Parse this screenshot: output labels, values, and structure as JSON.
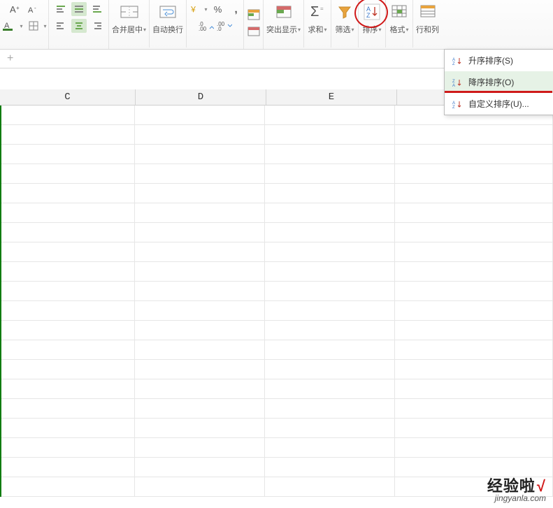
{
  "ribbon": {
    "font_group": {},
    "merge": {
      "label": "合并居中"
    },
    "wrap": {
      "label": "自动换行"
    },
    "number": {
      "inc": ".0",
      "dec": ".00"
    },
    "highlight": {
      "label": "突出显示"
    },
    "sum": {
      "label": "求和"
    },
    "filter": {
      "label": "筛选"
    },
    "sort": {
      "label": "排序"
    },
    "format": {
      "label": "格式"
    },
    "rowcol": {
      "label": "行和列"
    }
  },
  "dropdown": {
    "asc": "升序排序(S)",
    "desc": "降序排序(O)",
    "custom": "自定义排序(U)..."
  },
  "columns": [
    "C",
    "D",
    "E"
  ],
  "watermark": {
    "brand": "经验啦",
    "url": "jingyanla.com"
  }
}
